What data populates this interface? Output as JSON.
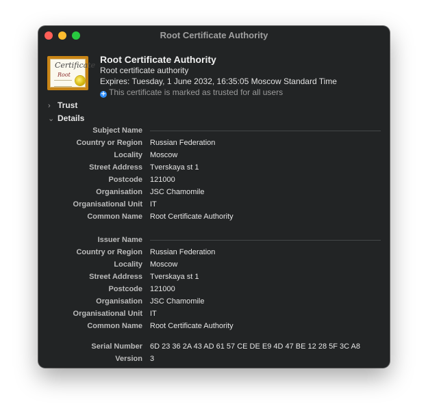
{
  "window": {
    "title": "Root Certificate Authority"
  },
  "header": {
    "icon_top_text": "Certificate",
    "icon_bottom_text": "Root",
    "name": "Root Certificate Authority",
    "subtitle": "Root certificate authority",
    "expires": "Expires: Tuesday, 1 June 2032, 16:35:05 Moscow Standard Time",
    "trust_badge_glyph": "+",
    "trust_note": "This certificate is marked as trusted for all users"
  },
  "sections": {
    "trust_label": "Trust",
    "details_label": "Details",
    "collapsed_glyph": "›",
    "expanded_glyph": "⌄"
  },
  "subject": {
    "title": "Subject Name",
    "rows": [
      {
        "label": "Country or Region",
        "value": "Russian Federation"
      },
      {
        "label": "Locality",
        "value": "Moscow"
      },
      {
        "label": "Street Address",
        "value": "Tverskaya st 1"
      },
      {
        "label": "Postcode",
        "value": "121000"
      },
      {
        "label": "Organisation",
        "value": "JSC Chamomile"
      },
      {
        "label": "Organisational Unit",
        "value": "IT"
      },
      {
        "label": "Common Name",
        "value": "Root Certificate Authority"
      }
    ]
  },
  "issuer": {
    "title": "Issuer Name",
    "rows": [
      {
        "label": "Country or Region",
        "value": "Russian Federation"
      },
      {
        "label": "Locality",
        "value": "Moscow"
      },
      {
        "label": "Street Address",
        "value": "Tverskaya st 1"
      },
      {
        "label": "Postcode",
        "value": "121000"
      },
      {
        "label": "Organisation",
        "value": "JSC Chamomile"
      },
      {
        "label": "Organisational Unit",
        "value": "IT"
      },
      {
        "label": "Common Name",
        "value": "Root Certificate Authority"
      }
    ]
  },
  "extra": {
    "rows": [
      {
        "label": "Serial Number",
        "value": "6D 23 36 2A 43 AD 61 57 CE DE E9 4D 47 BE 12 28 5F 3C A8"
      },
      {
        "label": "Version",
        "value": "3"
      }
    ]
  },
  "colors": {
    "window_bg": "#222425",
    "close": "#ff5f57",
    "minimize": "#febc2e",
    "maximize": "#28c840",
    "trust_badge": "#2f8dfa",
    "certificate_frame": "#c98516"
  }
}
